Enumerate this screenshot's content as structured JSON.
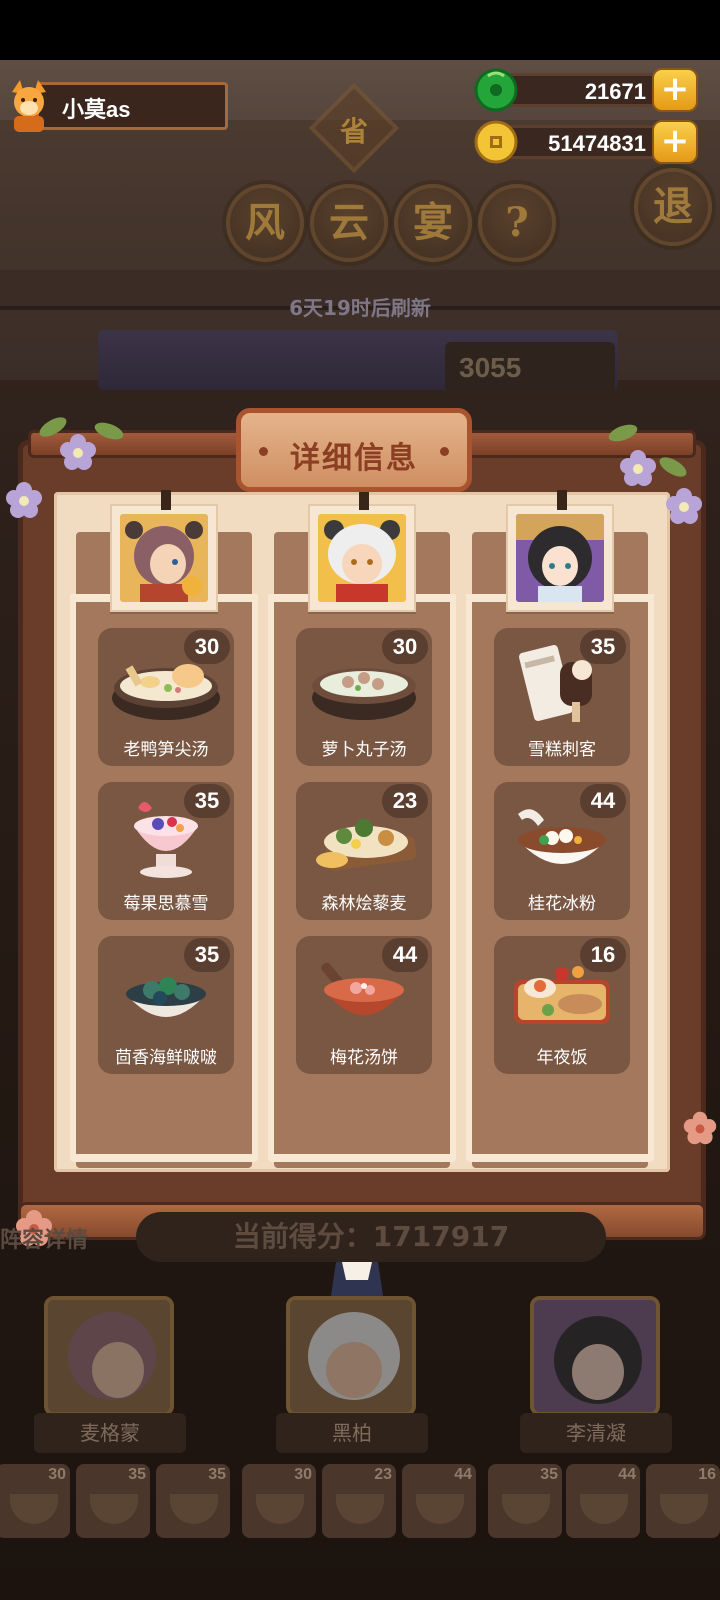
{
  "player": {
    "name": "小莫as"
  },
  "currency": {
    "jade": {
      "value": "21671"
    },
    "coins": {
      "value": "51474831"
    },
    "plus_label": "+"
  },
  "header": {
    "rank_badge": "省",
    "title_chars": [
      "风",
      "云",
      "宴"
    ],
    "help_label": "?",
    "exit_label": "退",
    "refresh_text": "6天19时后刷新",
    "score_partial": "3055"
  },
  "modal": {
    "title": "详细信息",
    "columns": [
      {
        "character": "麦格蒙",
        "dishes": [
          {
            "name": "老鸭笋尖汤",
            "value": "30",
            "icon": "duck-soup-icon"
          },
          {
            "name": "莓果思慕雪",
            "value": "35",
            "icon": "berry-smoothie-icon"
          },
          {
            "name": "茴香海鲜啵啵",
            "value": "35",
            "icon": "seafood-bowl-icon"
          }
        ]
      },
      {
        "character": "黑柏",
        "dishes": [
          {
            "name": "萝卜丸子汤",
            "value": "30",
            "icon": "meatball-soup-icon"
          },
          {
            "name": "森林烩藜麦",
            "value": "23",
            "icon": "quinoa-platter-icon"
          },
          {
            "name": "梅花汤饼",
            "value": "44",
            "icon": "plum-soup-icon"
          }
        ]
      },
      {
        "character": "李清凝",
        "dishes": [
          {
            "name": "雪糕刺客",
            "value": "35",
            "icon": "ice-cream-icon"
          },
          {
            "name": "桂花冰粉",
            "value": "44",
            "icon": "osmanthus-jelly-icon"
          },
          {
            "name": "年夜饭",
            "value": "16",
            "icon": "feast-icon"
          }
        ]
      }
    ]
  },
  "bottom": {
    "lineup_label": "阵容详情",
    "current_score_label": "当前得分：1717917",
    "heroes": [
      "麦格蒙",
      "黑柏",
      "李清凝"
    ],
    "mini_dishes": [
      "30",
      "35",
      "35",
      "30",
      "23",
      "44",
      "35",
      "44",
      "16"
    ]
  },
  "colors": {
    "frame_brown": "#6a3d2b",
    "paper": "#f1dcc2",
    "dish_card": "#7a5743",
    "accent_gold": "#e59a17",
    "title_red": "#8a3e22"
  }
}
